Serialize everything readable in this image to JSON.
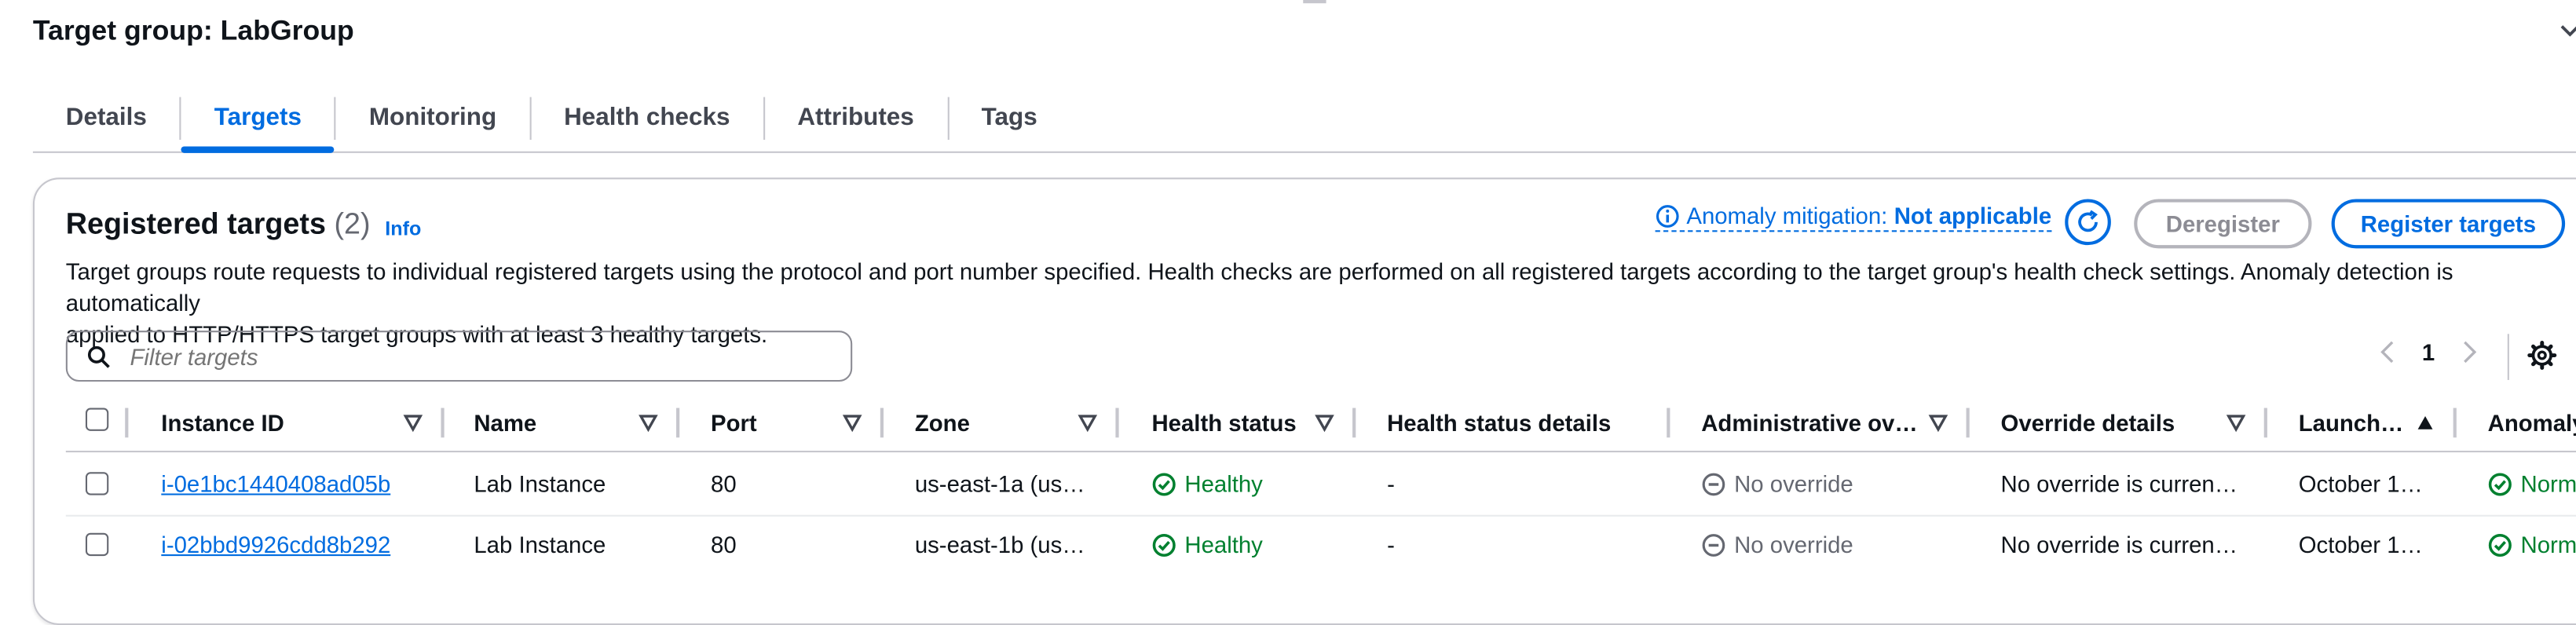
{
  "page": {
    "title": "Target group: LabGroup"
  },
  "tabs": [
    {
      "label": "Details"
    },
    {
      "label": "Targets"
    },
    {
      "label": "Monitoring"
    },
    {
      "label": "Health checks"
    },
    {
      "label": "Attributes"
    },
    {
      "label": "Tags"
    }
  ],
  "active_tab": "Targets",
  "panel": {
    "title": "Registered targets",
    "count": "(2)",
    "info": "Info",
    "description_line1": "Target groups route requests to individual registered targets using the protocol and port number specified. Health checks are performed on all registered targets according to the target group's health check settings. Anomaly detection is automatically",
    "description_line2": "applied to HTTP/HTTPS target groups with at least 3 healthy targets.",
    "anomaly_label": "Anomaly mitigation:",
    "anomaly_value": "Not applicable",
    "deregister_label": "Deregister",
    "register_label": "Register targets"
  },
  "filter": {
    "placeholder": "Filter targets"
  },
  "pagination": {
    "current_page": "1"
  },
  "table": {
    "headers": {
      "instance_id": "Instance ID",
      "name": "Name",
      "port": "Port",
      "zone": "Zone",
      "health_status": "Health status",
      "health_details": "Health status details",
      "admin_override": "Administrative ov…",
      "override_details": "Override details",
      "launch": "Launch…",
      "anomaly": "Anomaly"
    },
    "rows": [
      {
        "instance_id": "i-0e1bc1440408ad05b",
        "name": "Lab Instance",
        "port": "80",
        "zone": "us-east-1a (us…",
        "health_status": "Healthy",
        "health_details": "-",
        "admin_override": "No override",
        "override_details": "No override is curren…",
        "launch": "October 1…",
        "anomaly": "Normal"
      },
      {
        "instance_id": "i-02bbd9926cdd8b292",
        "name": "Lab Instance",
        "port": "80",
        "zone": "us-east-1b (us…",
        "health_status": "Healthy",
        "health_details": "-",
        "admin_override": "No override",
        "override_details": "No override is curren…",
        "launch": "October 1…",
        "anomaly": "Normal"
      }
    ]
  },
  "colors": {
    "accent": "#006ce0",
    "healthy": "#00802f",
    "border": "#c6c6cd",
    "text": "#0f141a",
    "muted": "#656871"
  },
  "icons": {
    "info": "info-circle-icon",
    "refresh": "refresh-icon",
    "search": "search-icon",
    "settings": "gear-icon",
    "healthy": "check-circle-icon",
    "no_override": "minus-circle-icon",
    "sort": "sort-triangle-icon",
    "pager_prev": "chevron-left-icon",
    "pager_next": "chevron-right-icon",
    "collapse": "chevron-down-icon"
  }
}
